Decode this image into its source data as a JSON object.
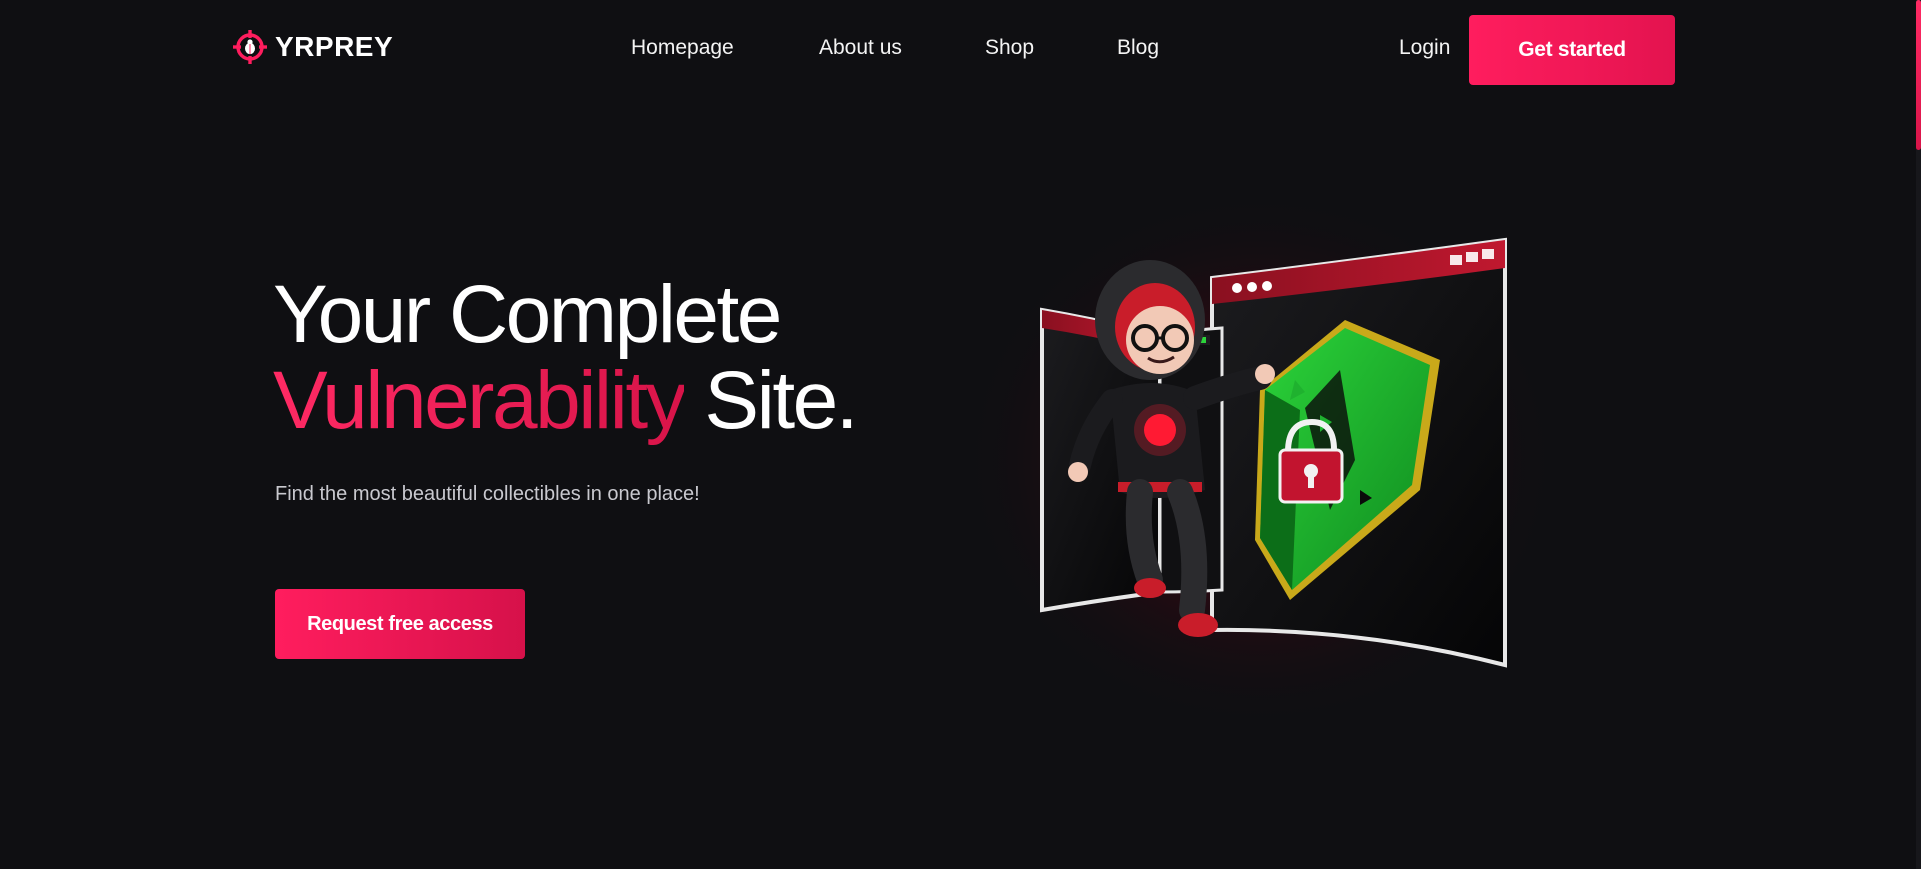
{
  "brand": {
    "name": "YRPREY",
    "accent_color": "#ff1d5e",
    "logo_icon": "crosshair-bug-icon"
  },
  "nav": {
    "items": [
      {
        "label": "Homepage"
      },
      {
        "label": "About us"
      },
      {
        "label": "Shop"
      },
      {
        "label": "Blog"
      }
    ],
    "login_label": "Login",
    "cta_label": "Get started"
  },
  "hero": {
    "title_line1": "Your Complete",
    "title_accent": "Vulnerability",
    "title_end": " Site.",
    "subtitle": "Find the most beautiful collectibles in one place!",
    "button_label": "Request free access"
  },
  "illustration": {
    "subject": "hacker-character-breaking-shield-icon"
  }
}
